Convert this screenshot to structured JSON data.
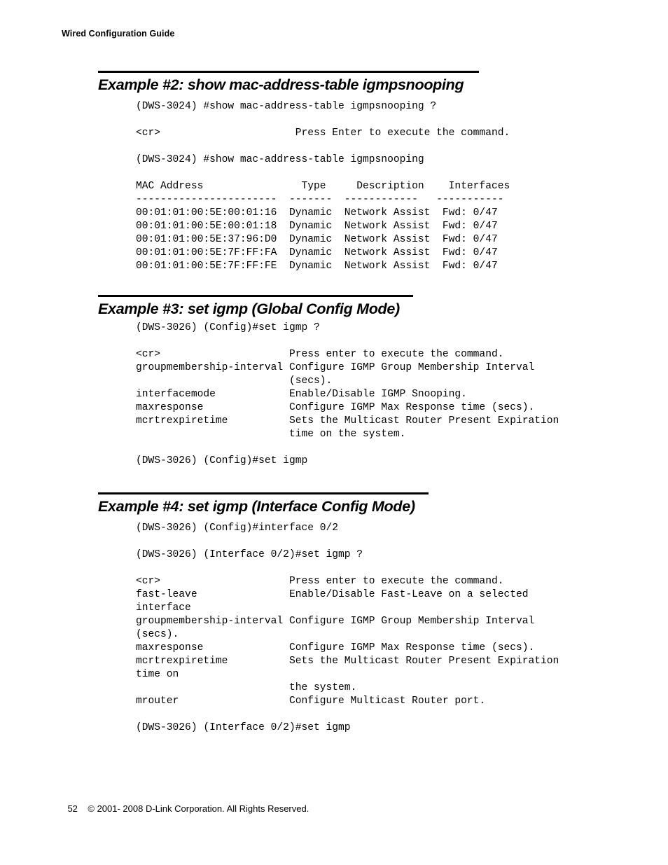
{
  "header": {
    "running_title": "Wired Configuration Guide"
  },
  "sections": [
    {
      "id": "example-2",
      "heading": "Example #2: show mac-address-table igmpsnooping",
      "rule_width": 544,
      "code": "(DWS-3024) #show mac-address-table igmpsnooping ?\n\n<cr>                      Press Enter to execute the command.\n\n(DWS-3024) #show mac-address-table igmpsnooping\n\nMAC Address                Type     Description    Interfaces\n-----------------------  -------  ------------   -----------\n00:01:01:00:5E:00:01:16  Dynamic  Network Assist  Fwd: 0/47\n00:01:01:00:5E:00:01:18  Dynamic  Network Assist  Fwd: 0/47\n00:01:01:00:5E:37:96:D0  Dynamic  Network Assist  Fwd: 0/47\n00:01:01:00:5E:7F:FF:FA  Dynamic  Network Assist  Fwd: 0/47\n00:01:01:00:5E:7F:FF:FE  Dynamic  Network Assist  Fwd: 0/47"
    },
    {
      "id": "example-3",
      "heading": "Example #3: set igmp (Global Config Mode)",
      "rule_width": 450,
      "code": "(DWS-3026) (Config)#set igmp ?\n\n<cr>                     Press enter to execute the command.\ngroupmembership-interval Configure IGMP Group Membership Interval\n                         (secs).\ninterfacemode            Enable/Disable IGMP Snooping.\nmaxresponse              Configure IGMP Max Response time (secs).\nmcrtrexpiretime          Sets the Multicast Router Present Expiration\n                         time on the system.\n\n(DWS-3026) (Config)#set igmp"
    },
    {
      "id": "example-4",
      "heading": "Example #4: set igmp (Interface Config Mode)",
      "rule_width": 472,
      "code": "(DWS-3026) (Config)#interface 0/2\n\n(DWS-3026) (Interface 0/2)#set igmp ?\n\n<cr>                     Press enter to execute the command.\nfast-leave               Enable/Disable Fast-Leave on a selected\ninterface\ngroupmembership-interval Configure IGMP Group Membership Interval\n(secs).\nmaxresponse              Configure IGMP Max Response time (secs).\nmcrtrexpiretime          Sets the Multicast Router Present Expiration\ntime on\n                         the system.\nmrouter                  Configure Multicast Router port.\n\n(DWS-3026) (Interface 0/2)#set igmp"
    }
  ],
  "footer": {
    "page_number": "52",
    "copyright": "© 2001- 2008 D-Link Corporation. All Rights Reserved."
  }
}
